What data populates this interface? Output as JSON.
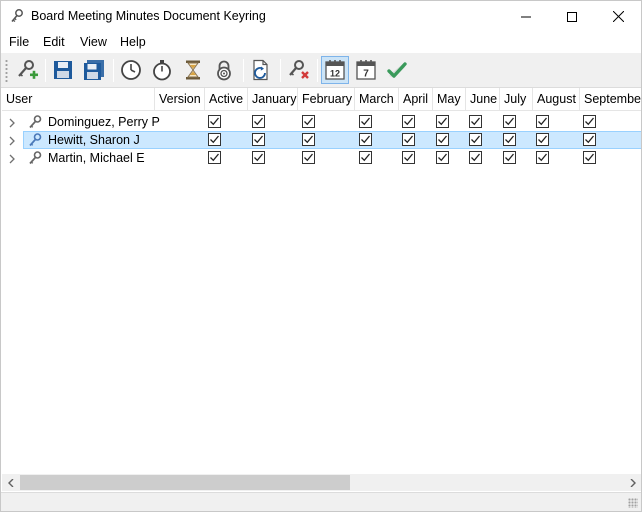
{
  "window": {
    "title": "Board Meeting Minutes Document Keyring"
  },
  "menu": {
    "items": [
      "File",
      "Edit",
      "View",
      "Help"
    ]
  },
  "toolbar": {
    "buttons": [
      {
        "icon": "add-key-icon"
      },
      {
        "icon": "save-icon"
      },
      {
        "icon": "save-all-icon"
      },
      {
        "icon": "clock-icon"
      },
      {
        "icon": "stopwatch-icon"
      },
      {
        "icon": "hourglass-icon"
      },
      {
        "icon": "padlock-icon"
      },
      {
        "icon": "refresh-document-icon"
      },
      {
        "icon": "remove-key-icon"
      },
      {
        "icon": "calendar-12-icon",
        "text": "12",
        "pressed": true
      },
      {
        "icon": "calendar-7-icon",
        "text": "7"
      },
      {
        "icon": "check-icon"
      }
    ]
  },
  "grid": {
    "columns": [
      "User",
      "Version",
      "Active",
      "January",
      "February",
      "March",
      "April",
      "May",
      "June",
      "July",
      "August",
      "September"
    ],
    "rows": [
      {
        "user": "Dominguez, Perry P",
        "selected": false,
        "checks": [
          true,
          true,
          true,
          true,
          true,
          true,
          true,
          true,
          true,
          true
        ]
      },
      {
        "user": "Hewitt, Sharon J",
        "selected": true,
        "checks": [
          true,
          true,
          true,
          true,
          true,
          true,
          true,
          true,
          true,
          true
        ]
      },
      {
        "user": "Martin, Michael E",
        "selected": false,
        "checks": [
          true,
          true,
          true,
          true,
          true,
          true,
          true,
          true,
          true,
          true
        ]
      }
    ]
  },
  "colors": {
    "selection": "#cce8ff",
    "selection_border": "#99d1ff",
    "toolbar_bg": "#f0f0f0",
    "pressed": "#cce4f7",
    "accent_blue": "#1e5a9c",
    "check_green": "#3a9a5b"
  }
}
